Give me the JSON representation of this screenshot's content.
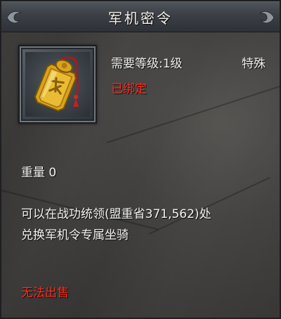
{
  "tooltip": {
    "title": "军机密令",
    "required_level": "需要等级:1级",
    "category": "特殊",
    "bound_status": "已绑定",
    "weight": "重量 0",
    "description_lines": [
      "可以在战功统领(盟重省371,562)处",
      "兑换军机令专属坐骑"
    ],
    "sell_status": "无法出售"
  },
  "icons": {
    "item_icon": "golden-military-token-icon",
    "header_ornament": "ornament-corner-icon"
  },
  "colors": {
    "bound_text": "#ff2a1a",
    "unsellable_text": "#ff2a1a",
    "normal_text": "#f2f2f2",
    "token_gold": "#d8a21c"
  }
}
